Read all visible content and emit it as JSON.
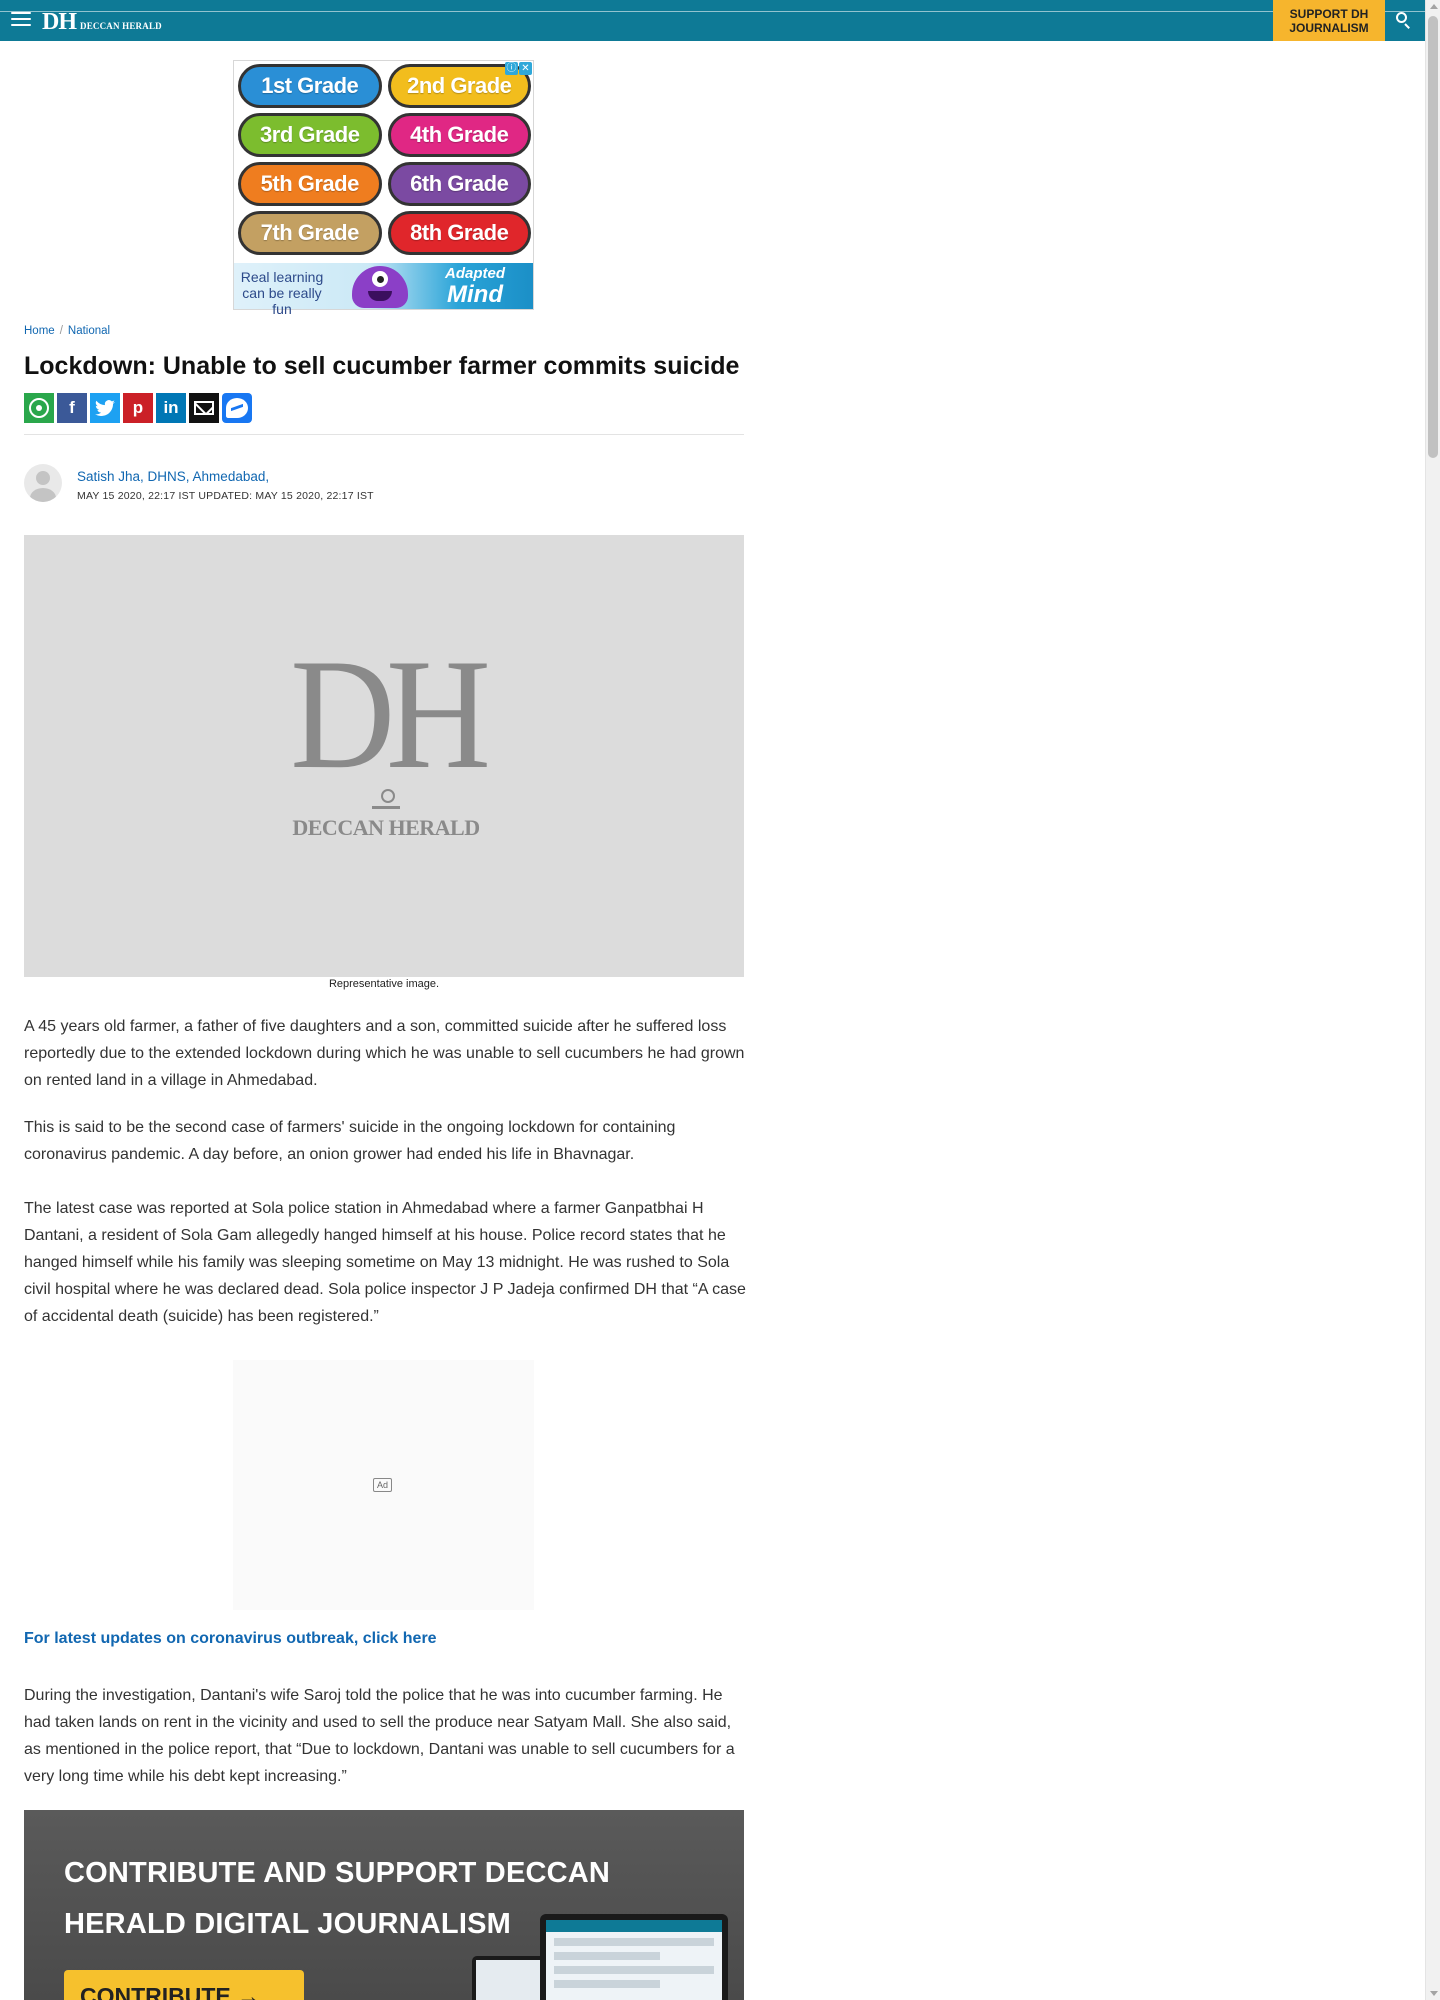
{
  "header": {
    "logo_mark": "DH",
    "logo_name": "DECCAN HERALD",
    "support_label": "SUPPORT DH JOURNALISM",
    "brand_color": "#0e7a96",
    "support_color": "#f6b52d"
  },
  "ad_top": {
    "grades": [
      {
        "label": "1st Grade",
        "color": "#2a8fd6"
      },
      {
        "label": "2nd Grade",
        "color": "#f2bd1d"
      },
      {
        "label": "3rd Grade",
        "color": "#7cbd2e"
      },
      {
        "label": "4th Grade",
        "color": "#e02784"
      },
      {
        "label": "5th Grade",
        "color": "#ef7d1f"
      },
      {
        "label": "6th Grade",
        "color": "#7b4aa2"
      },
      {
        "label": "7th Grade",
        "color": "#c3a062"
      },
      {
        "label": "8th Grade",
        "color": "#e0262b"
      }
    ],
    "tagline": "Real learning can be really fun",
    "brand_line1": "Adapted",
    "brand_line2": "Mind",
    "choices_icons": [
      "adchoices-icon",
      "close-icon"
    ]
  },
  "breadcrumb": {
    "items": [
      "Home",
      "National"
    ],
    "separator": "/"
  },
  "article": {
    "title": "Lockdown: Unable to sell cucumber farmer commits suicide",
    "author": "Satish Jha, DHNS, Ahmedabad,",
    "dateline": "MAY 15 2020, 22:17 IST  UPDATED: MAY 15 2020, 22:17 IST",
    "image_placeholder_mark": "DH",
    "image_placeholder_name": "DECCAN HERALD",
    "caption": "Representative image.",
    "paragraphs": [
      "A 45 years old farmer, a father of five daughters and a son, committed suicide after he suffered loss reportedly due to the extended lockdown during which he was unable to sell cucumbers he had grown on rented land in a village in Ahmedabad.",
      "This is said to be the second case of farmers' suicide in the ongoing lockdown for containing coronavirus pandemic. A day before, an onion grower had ended his life in Bhavnagar.",
      "The latest case was reported at Sola police station in Ahmedabad where a farmer Ganpatbhai H Dantani, a resident of Sola Gam allegedly hanged himself at his house. Police record states that he hanged himself while his family was sleeping sometime on May 13 midnight. He was rushed to Sola civil hospital where he was declared dead. Sola police inspector J P Jadeja confirmed DH that “A case of accidental death (suicide) has been registered.”",
      "During the investigation, Dantani's wife Saroj told the police that he was into cucumber farming. He had taken lands on rent in the vicinity and used to sell the produce near Satyam Mall. She also said, as mentioned in the police report, that “Due to lockdown, Dantani was unable to sell cucumbers for a very long time while his debt kept increasing.”"
    ],
    "update_link": "For latest updates on coronavirus outbreak, click here"
  },
  "share": {
    "icons": [
      "whatsapp-icon",
      "facebook-icon",
      "twitter-icon",
      "pinterest-icon",
      "linkedin-icon",
      "email-icon",
      "messenger-icon"
    ],
    "labels": {
      "facebook": "f",
      "pinterest": "p",
      "linkedin": "in"
    }
  },
  "ad_mid": {
    "tag": "Ad"
  },
  "promo": {
    "headline": "CONTRIBUTE AND SUPPORT DECCAN HERALD DIGITAL JOURNALISM",
    "cta": "CONTRIBUTE →"
  }
}
